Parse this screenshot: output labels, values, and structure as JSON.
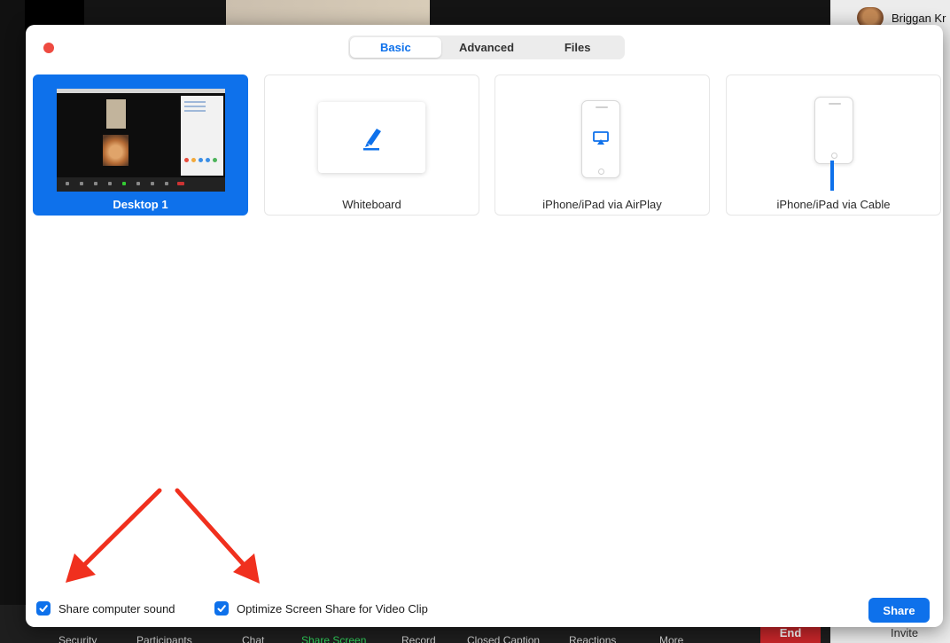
{
  "background": {
    "participant_name": "Briggan Kr",
    "toolbar": {
      "items": [
        "Security",
        "Participants",
        "Chat",
        "Share Screen",
        "Record",
        "Closed Caption",
        "Reactions",
        "More"
      ],
      "end_label": "End",
      "invite_label": "Invite"
    }
  },
  "dialog": {
    "tabs": [
      "Basic",
      "Advanced",
      "Files"
    ],
    "active_tab": "Basic",
    "options": [
      {
        "label": "Desktop 1",
        "selected": true,
        "icon": "desktop-thumbnail"
      },
      {
        "label": "Whiteboard",
        "selected": false,
        "icon": "pen-icon"
      },
      {
        "label": "iPhone/iPad via AirPlay",
        "selected": false,
        "icon": "airplay-icon"
      },
      {
        "label": "iPhone/iPad via Cable",
        "selected": false,
        "icon": "cable-icon"
      }
    ],
    "checkboxes": [
      {
        "label": "Share computer sound",
        "checked": true
      },
      {
        "label": "Optimize Screen Share for Video Clip",
        "checked": true
      }
    ],
    "share_label": "Share"
  },
  "colors": {
    "accent": "#0e71eb",
    "close_dot": "#ee4b41",
    "annotation_arrow": "#f0301e",
    "end_button": "#c8262a",
    "share_screen_active": "#2fd05a"
  }
}
